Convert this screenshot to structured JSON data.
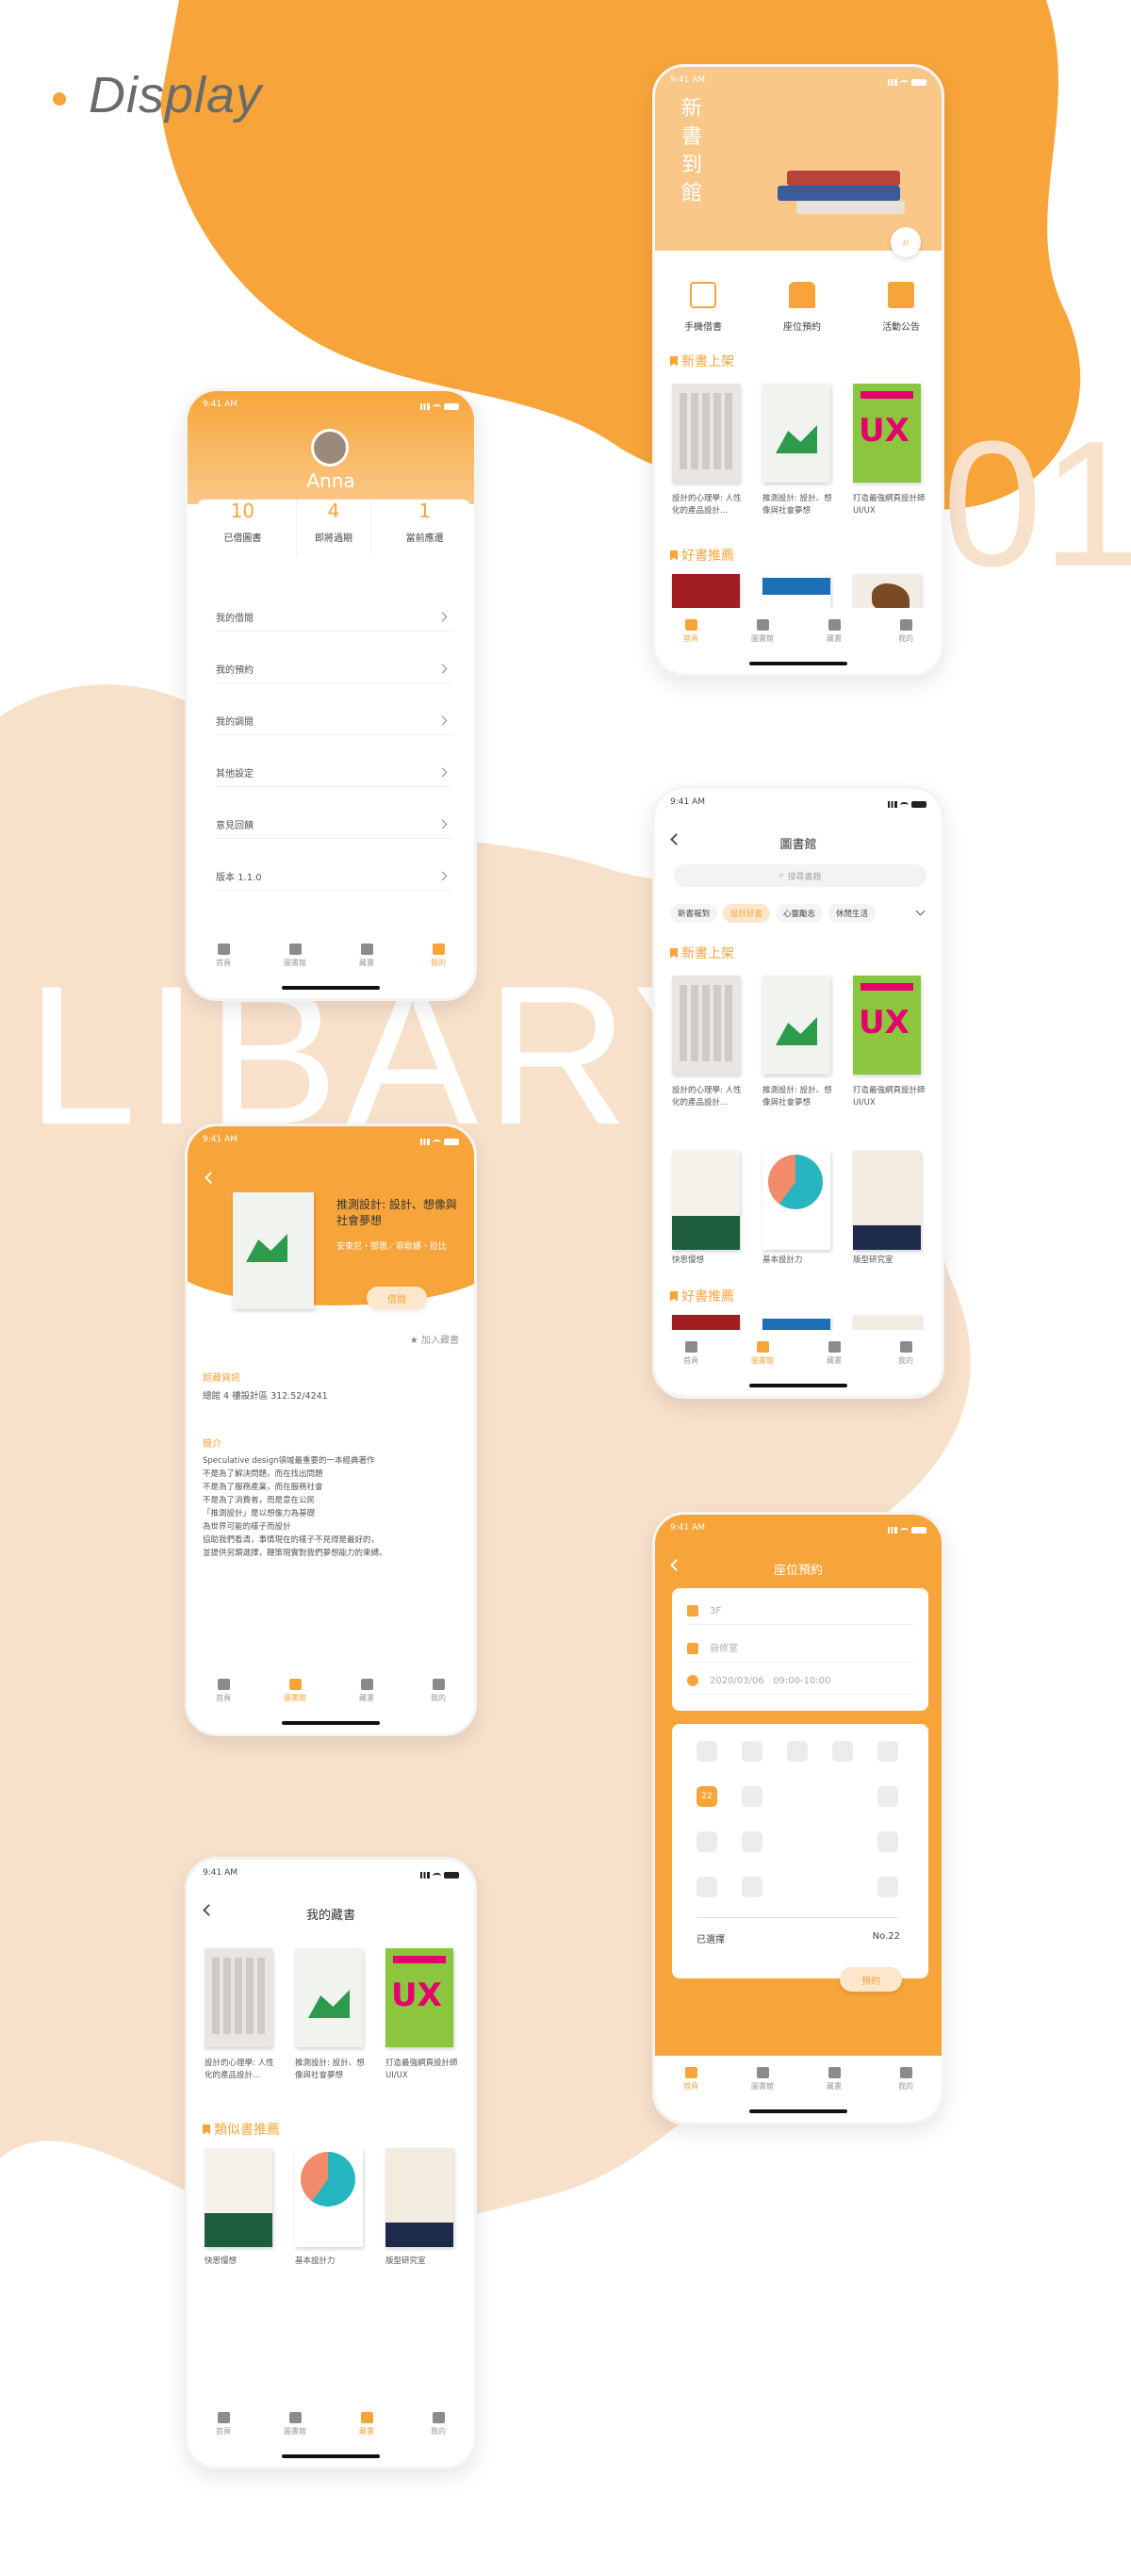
{
  "headline": "Display",
  "big_word": "LIBARY",
  "big_number": "01",
  "status_time": "9:41 AM",
  "tabbar": [
    "首頁",
    "圖書館",
    "藏書",
    "我的"
  ],
  "home": {
    "banner_title": "新書到館",
    "actions": [
      "手機借書",
      "座位預約",
      "活動公告"
    ],
    "new_books_title": "新書上架",
    "recommend_title": "好書推薦",
    "books": [
      "設計的心理學: 人性化的產品設計...",
      "推測設計: 設計、想像與社會夢想",
      "打造最強網頁設計師 UI/UX"
    ]
  },
  "profile": {
    "name": "Anna",
    "stats": [
      {
        "value": "10",
        "label": "已借圖書"
      },
      {
        "value": "4",
        "label": "即將過期"
      },
      {
        "value": "1",
        "label": "當前應還"
      }
    ],
    "menu": [
      "我的借閱",
      "我的預約",
      "我的調閱",
      "其他設定",
      "意見回饋",
      "版本 1.1.0"
    ]
  },
  "library": {
    "title": "圖書館",
    "search_placeholder": "搜尋書籍",
    "chips": [
      "新書報到",
      "設計好書",
      "心靈勵志",
      "休閒生活"
    ],
    "new_books_title": "新書上架",
    "recommend_title": "好書推薦",
    "books": [
      "設計的心理學: 人性化的產品設計...",
      "推測設計: 設計、想像與社會夢想",
      "打造最強網頁設計師 UI/UX",
      "快思慢想",
      "基本設計力",
      "版型研究室"
    ]
  },
  "detail": {
    "title": "推測設計: 設計、想像與社會夢想",
    "authors": "安東尼・鄧恩／菲歐娜・拉比",
    "borrow_label": "借閱",
    "collect_label": "加入藏書",
    "location_title": "館藏資訊",
    "location_text": "總館 4 樓設計區 312.52/4241",
    "intro_title": "簡介",
    "intro_lines": [
      "Speculative design領域最重要的一本經典著作",
      "不是為了解決問題，而在找出問題",
      "不是為了服務產業，而在服務社會",
      "不是為了消費者，而是意在公民",
      "「推測設計」是以想像力為基礎",
      "為世界可能的樣子而設計",
      "協助我們看清，事情現在的樣子不見得是最好的，",
      "並提供另類選擇，鞭策現實對我們夢想能力的束縛。"
    ]
  },
  "seat": {
    "title": "座位預約",
    "floor": "3F",
    "room": "自修室",
    "date": "2020/03/06",
    "time": "09:00-10:00",
    "selected_seat": "22",
    "selected_label": "已選擇",
    "selected_value": "No.22",
    "reserve_label": "預約"
  },
  "collection": {
    "title": "我的藏書",
    "similar_title": "類似書推薦",
    "books": [
      "設計的心理學: 人性化的產品設計...",
      "推測設計: 設計、想像與社會夢想",
      "打造最強網頁設計師 UI/UX",
      "快思慢想",
      "基本設計力",
      "版型研究室"
    ]
  },
  "colors": {
    "accent": "#f7a53a",
    "accent_light": "#f8e1cb"
  }
}
